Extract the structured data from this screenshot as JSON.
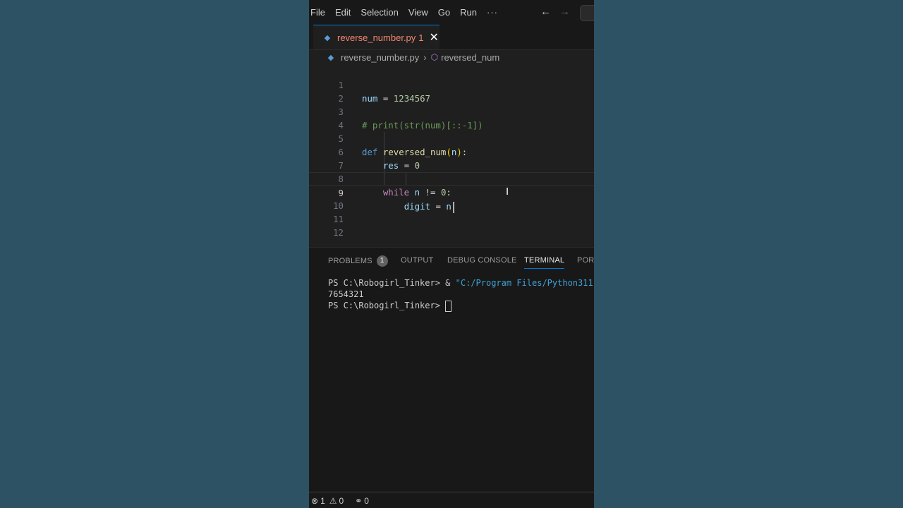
{
  "menu": {
    "items": [
      "File",
      "Edit",
      "Selection",
      "View",
      "Go",
      "Run"
    ],
    "more": "···",
    "back_icon": "arrow-left-icon",
    "forward_icon": "arrow-right-icon"
  },
  "tab": {
    "filename": "reverse_number.py",
    "problems": "1",
    "close": "✕"
  },
  "breadcrumb": {
    "file": "reverse_number.py",
    "separator": "›",
    "symbol": "reversed_num"
  },
  "editor": {
    "line_numbers": [
      "1",
      "2",
      "3",
      "4",
      "5",
      "6",
      "7",
      "8",
      "9",
      "10",
      "11",
      "12"
    ],
    "current_line": 9,
    "code": {
      "l1_var": "num",
      "l1_op": " = ",
      "l1_num": "1234567",
      "l3_comment": "# print(str(num)[::-1])",
      "l5_kw": "def",
      "l5_fn": "reversed_num",
      "l5_open": "(",
      "l5_param": "n",
      "l5_close": ")",
      "l5_colon": ":",
      "l6_var": "res",
      "l6_op": " = ",
      "l6_num": "0",
      "l8_kw": "while",
      "l8_var": "n",
      "l8_op": " != ",
      "l8_num": "0",
      "l8_colon": ":",
      "l9_var": "digit",
      "l9_op": " = ",
      "l9_var2": "n"
    }
  },
  "panel": {
    "tabs": [
      "PROBLEMS",
      "OUTPUT",
      "DEBUG CONSOLE",
      "TERMINAL",
      "PORTS"
    ],
    "active_tab": "TERMINAL",
    "problems_count": "1",
    "terminal": {
      "line1_prompt": "PS C:\\Robogirl_Tinker> & ",
      "line1_path": "\"C:/Program Files/Python311",
      "line2": "7654321",
      "line3_prompt": "PS C:\\Robogirl_Tinker> "
    }
  },
  "statusbar": {
    "errors": "1",
    "warnings": "0",
    "ports": "0"
  },
  "colors": {
    "accent": "#0078d4",
    "tab_error_text": "#f48771",
    "background_outer": "#2d5263"
  }
}
